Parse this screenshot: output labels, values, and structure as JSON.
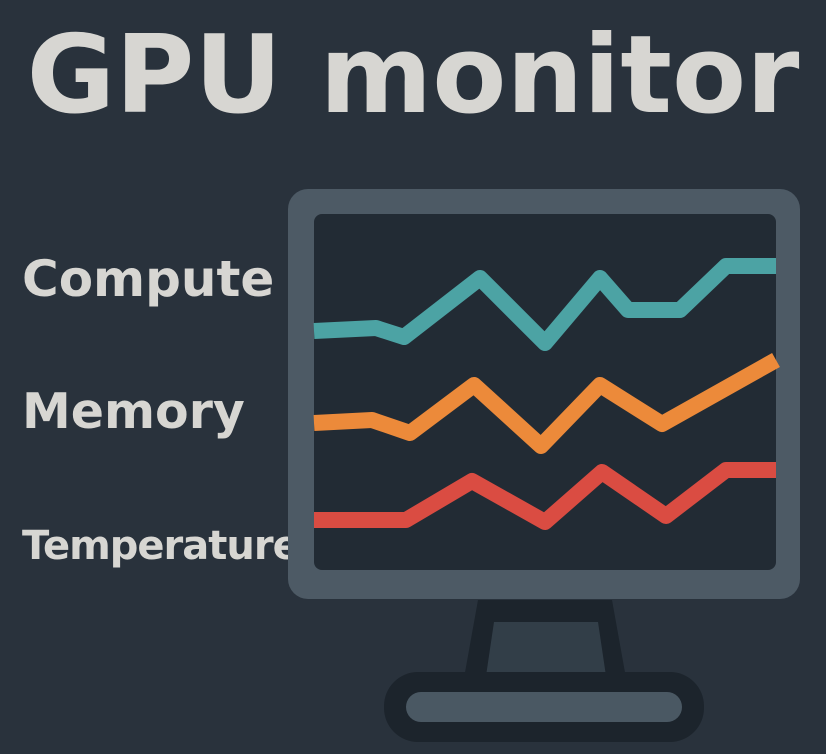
{
  "title": "GPU monitor",
  "metrics": [
    {
      "label": "Compute",
      "color": "#4ca3a4"
    },
    {
      "label": "Memory",
      "color": "#ec8a3a"
    },
    {
      "label": "Temperature",
      "color": "#da4c42"
    }
  ],
  "colors": {
    "background": "#29323c",
    "text": "#d7d6d2",
    "monitor_frame": "#4d5a65",
    "screen": "#222b34",
    "stand": "#323e48"
  }
}
